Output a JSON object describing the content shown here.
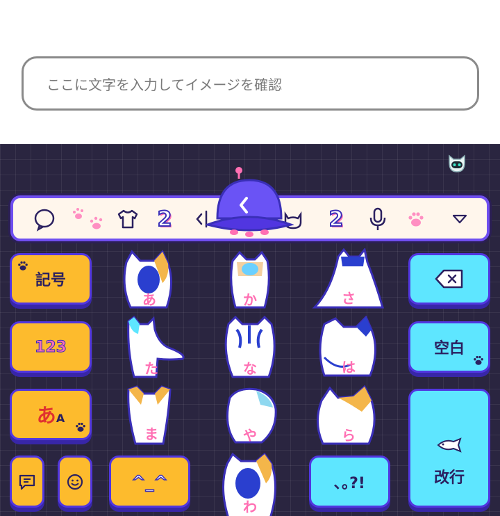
{
  "preview": {
    "placeholder": "ここに文字を入力してイメージを確認"
  },
  "toolbar": {
    "num_left": "2",
    "num_right": "2",
    "icons": [
      "search-icon",
      "paw-print-icon",
      "tshirt-icon",
      "number-2-icon",
      "cursor-move-icon",
      "back-arrow-icon",
      "cat-face-icon",
      "number-2-icon",
      "microphone-icon",
      "paw-icon",
      "chevron-down-icon"
    ]
  },
  "keys": {
    "symbols": "記号",
    "numbers": "123",
    "kana_a": "あ",
    "kana_sub": "A",
    "emoticon": "^_^",
    "punct": "､｡?!",
    "backspace_icon": "backspace-icon",
    "space": "空白",
    "enter": "改行"
  },
  "kana": {
    "a": "あ",
    "ka": "か",
    "sa": "さ",
    "ta": "た",
    "na": "な",
    "ha": "は",
    "ma": "ま",
    "ya": "や",
    "ra": "ら",
    "wa": "わ"
  },
  "colors": {
    "keyboard_bg": "#2a2540",
    "key_yellow": "#fdbb2d",
    "key_cyan": "#5ee6ff",
    "key_border": "#5136e0",
    "accent_pink": "#ff6fb3"
  }
}
